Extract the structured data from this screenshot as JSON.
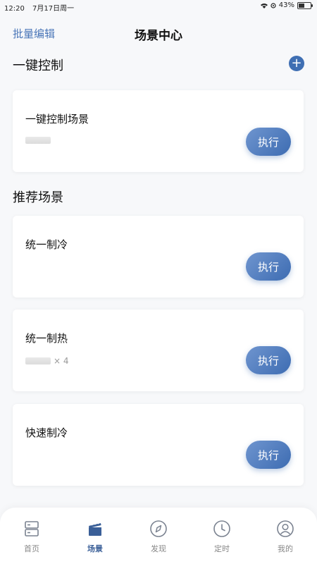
{
  "status": {
    "time": "12:20",
    "date": "7月17日周一",
    "battery": "43%"
  },
  "nav": {
    "left": "批量编辑",
    "title": "场景中心"
  },
  "sections": {
    "one_key": "一键控制",
    "recommended": "推荐场景"
  },
  "cards": [
    {
      "name": "一键控制场景",
      "meta": "",
      "button": "执行"
    },
    {
      "name": "统一制冷",
      "meta": "",
      "button": "执行"
    },
    {
      "name": "统一制热",
      "meta": "× 4",
      "button": "执行"
    },
    {
      "name": "快速制冷",
      "meta": "",
      "button": "执行"
    }
  ],
  "tabs": [
    {
      "label": "首页",
      "icon": "server-icon"
    },
    {
      "label": "场景",
      "icon": "clapperboard-icon",
      "active": true
    },
    {
      "label": "发现",
      "icon": "compass-icon"
    },
    {
      "label": "定时",
      "icon": "clock-icon"
    },
    {
      "label": "我的",
      "icon": "user-icon"
    }
  ],
  "colors": {
    "accent": "#3f6fb3",
    "tab_active": "#3a5f98"
  }
}
